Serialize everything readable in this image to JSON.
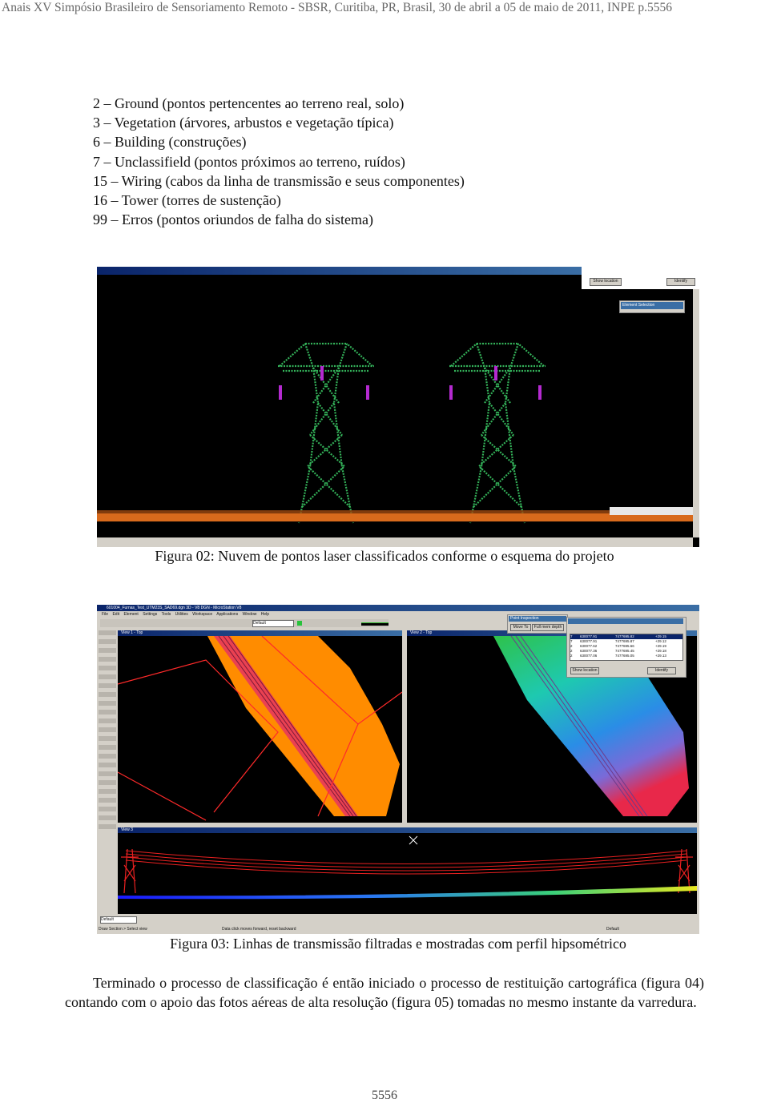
{
  "header": "Anais XV Simpósio Brasileiro de Sensoriamento Remoto - SBSR, Curitiba, PR, Brasil, 30 de abril a 05 de maio de 2011, INPE  p.5556",
  "classes": [
    "2 – Ground (pontos pertencentes ao terreno real, solo)",
    "3 – Vegetation (árvores, arbustos e vegetação típica)",
    "6 – Building (construções)",
    "7 – Unclassifield (pontos próximos ao terreno, ruídos)",
    "15 – Wiring (cabos da linha de transmissão e seus componentes)",
    "16 – Tower (torres de sustenção)",
    "99 – Erros (pontos oriundos de falha do sistema)"
  ],
  "figure2": {
    "caption": "Figura 02: Nuvem de pontos laser classificados conforme o esquema do projeto",
    "dialog_buttons": [
      "Show location",
      "Identify"
    ],
    "dialog2_title": "Element Selection"
  },
  "figure3": {
    "caption": "Figura 03: Linhas de transmissão filtradas e mostradas com perfil hipsométrico",
    "app_title": "601004_Furnas_Test_UTM23S_SAD69.dgn 3D - V8 DGN - MicroStation V8",
    "menu": [
      "File",
      "Edit",
      "Element",
      "Settings",
      "Tools",
      "Utilities",
      "Workspace",
      "Applications",
      "Window",
      "Help"
    ],
    "view1_title": "View 1 - Top",
    "view2_title": "View 2 - Top",
    "view3_title": "View 3",
    "status_left": "Draw Section > Select view",
    "status_mid": "Data click moves forward, reset backward",
    "level_default": "Default",
    "dialog_title": "Point Inspection",
    "dialog_buttons": [
      "Move To",
      "Full mem depth"
    ],
    "table_rows": [
      [
        "7",
        "630077.91",
        "7477695.82",
        "+29.15"
      ],
      [
        "7",
        "630077.91",
        "7477695.87",
        "+29.12"
      ],
      [
        "2",
        "630077.62",
        "7477695.66",
        "+29.19"
      ],
      [
        "2",
        "630077.36",
        "7477695.45",
        "+29.18"
      ],
      [
        "2",
        "630077.06",
        "7477695.05",
        "+29.13"
      ]
    ],
    "table_buttons": [
      "Show location",
      "Identify"
    ]
  },
  "paragraph": "Terminado o processo de classificação é então iniciado o processo de restituição cartográfica (figura 04) contando com o apoio das fotos aéreas de alta resolução (figura 05) tomadas no mesmo instante da varredura.",
  "page_number": "5556"
}
